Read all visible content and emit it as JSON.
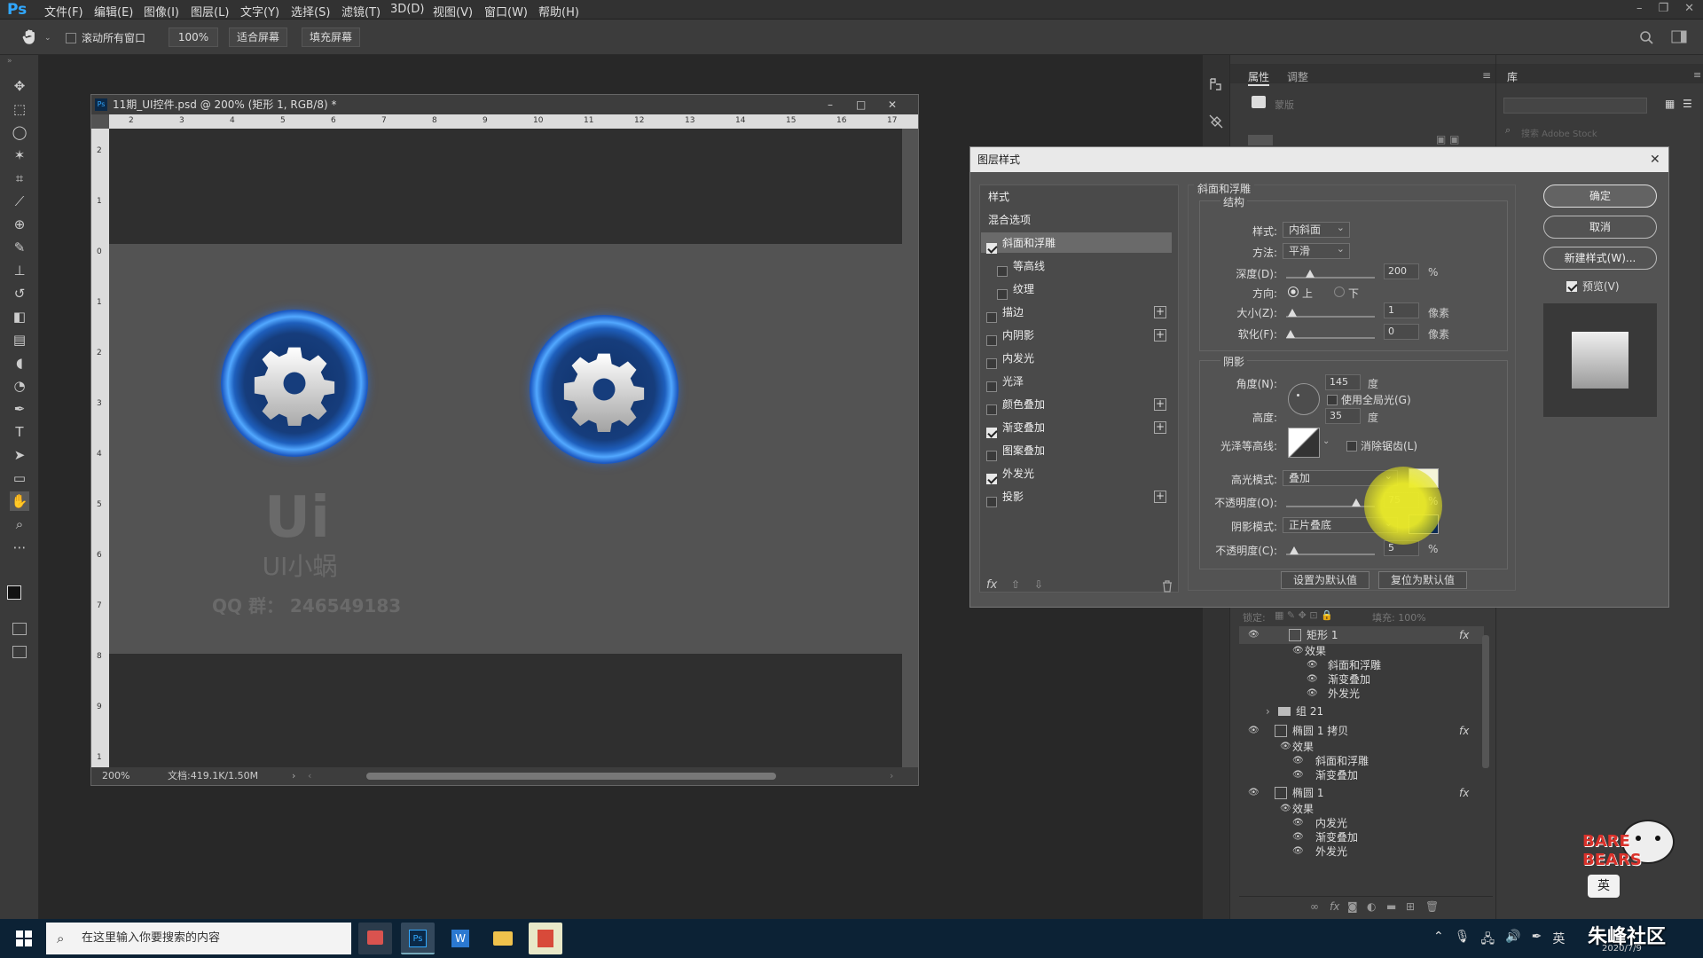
{
  "menubar": {
    "logo": "Ps",
    "items": [
      "文件(F)",
      "编辑(E)",
      "图像(I)",
      "图层(L)",
      "文字(Y)",
      "选择(S)",
      "滤镜(T)",
      "3D(D)",
      "视图(V)",
      "窗口(W)",
      "帮助(H)"
    ]
  },
  "options": {
    "scroll_all": "滚动所有窗口",
    "zoom_100": "100%",
    "fit_screen": "适合屏幕",
    "fill_screen": "填充屏幕"
  },
  "document": {
    "title": "11期_UI控件.psd @ 200% (矩形 1, RGB/8) *",
    "zoom": "200%",
    "doc_size": "文档:419.1K/1.50M",
    "ruler_h": [
      "2",
      "3",
      "4",
      "5",
      "6",
      "7",
      "8",
      "9",
      "10",
      "11",
      "12",
      "13",
      "14",
      "15",
      "16",
      "17"
    ],
    "ruler_v": [
      "2",
      "1",
      "0",
      "1",
      "2",
      "3",
      "4",
      "5",
      "6",
      "7",
      "8",
      "9",
      "1"
    ],
    "watermark_logo": "Ui",
    "watermark_name": "UI小蜗",
    "watermark_qq": "QQ 群： 246549183"
  },
  "props_panel": {
    "tabs": [
      "属性",
      "调整"
    ],
    "library_tab": "库",
    "mask_label": "蒙版",
    "search_placeholder": "搜索 Adobe Stock"
  },
  "dialog": {
    "title": "图层样式",
    "styles_header": "样式",
    "blend_options": "混合选项",
    "effects": [
      {
        "label": "斜面和浮雕",
        "checked": true,
        "indent": false,
        "plus": false,
        "active": true
      },
      {
        "label": "等高线",
        "checked": false,
        "indent": true,
        "plus": false,
        "active": false
      },
      {
        "label": "纹理",
        "checked": false,
        "indent": true,
        "plus": false,
        "active": false
      },
      {
        "label": "描边",
        "checked": false,
        "indent": false,
        "plus": true,
        "active": false
      },
      {
        "label": "内阴影",
        "checked": false,
        "indent": false,
        "plus": true,
        "active": false
      },
      {
        "label": "内发光",
        "checked": false,
        "indent": false,
        "plus": false,
        "active": false
      },
      {
        "label": "光泽",
        "checked": false,
        "indent": false,
        "plus": false,
        "active": false
      },
      {
        "label": "颜色叠加",
        "checked": false,
        "indent": false,
        "plus": true,
        "active": false
      },
      {
        "label": "渐变叠加",
        "checked": true,
        "indent": false,
        "plus": true,
        "active": false
      },
      {
        "label": "图案叠加",
        "checked": false,
        "indent": false,
        "plus": false,
        "active": false
      },
      {
        "label": "外发光",
        "checked": true,
        "indent": false,
        "plus": false,
        "active": false
      },
      {
        "label": "投影",
        "checked": false,
        "indent": false,
        "plus": true,
        "active": false
      }
    ],
    "fx_label": "fx",
    "section_title": "斜面和浮雕",
    "structure": {
      "title": "结构",
      "style_label": "样式:",
      "style_value": "内斜面",
      "technique_label": "方法:",
      "technique_value": "平滑",
      "depth_label": "深度(D):",
      "depth_value": "200",
      "depth_unit": "%",
      "direction_label": "方向:",
      "dir_up": "上",
      "dir_down": "下",
      "size_label": "大小(Z):",
      "size_value": "1",
      "size_unit": "像素",
      "soften_label": "软化(F):",
      "soften_value": "0",
      "soften_unit": "像素"
    },
    "shading": {
      "title": "阴影",
      "angle_label": "角度(N):",
      "angle_value": "145",
      "angle_unit": "度",
      "global_light": "使用全局光(G)",
      "altitude_label": "高度:",
      "altitude_value": "35",
      "altitude_unit": "度",
      "gloss_label": "光泽等高线:",
      "anti_alias": "消除锯齿(L)",
      "highlight_mode_label": "高光模式:",
      "highlight_mode": "叠加",
      "highlight_opacity_label": "不透明度(O):",
      "highlight_opacity": "75",
      "highlight_opacity_unit": "%",
      "shadow_mode_label": "阴影模式:",
      "shadow_mode": "正片叠底",
      "shadow_opacity_label": "不透明度(C):",
      "shadow_opacity": "5",
      "shadow_opacity_unit": "%"
    },
    "make_default": "设置为默认值",
    "reset_default": "复位为默认值",
    "ok": "确定",
    "cancel": "取消",
    "new_style": "新建样式(W)...",
    "preview": "预览(V)"
  },
  "layers": {
    "lock_label": "锁定:",
    "fill_label": "填充: 100%",
    "rows": [
      {
        "name": "矩形 1",
        "type": "layer",
        "fx": true,
        "eye": true
      },
      {
        "name": "效果",
        "type": "effects",
        "fx": false,
        "eye": true
      },
      {
        "name": "斜面和浮雕",
        "type": "effect",
        "fx": false,
        "eye": true
      },
      {
        "name": "渐变叠加",
        "type": "effect",
        "fx": false,
        "eye": true
      },
      {
        "name": "外发光",
        "type": "effect",
        "fx": false,
        "eye": true
      },
      {
        "name": "组 21",
        "type": "group",
        "fx": false,
        "eye": false
      },
      {
        "name": "椭圆 1 拷贝",
        "type": "layer",
        "fx": true,
        "eye": true
      },
      {
        "name": "效果",
        "type": "effects",
        "fx": false,
        "eye": true
      },
      {
        "name": "斜面和浮雕",
        "type": "effect",
        "fx": false,
        "eye": true
      },
      {
        "name": "渐变叠加",
        "type": "effect",
        "fx": false,
        "eye": true
      },
      {
        "name": "椭圆 1",
        "type": "layer",
        "fx": true,
        "eye": true
      },
      {
        "name": "效果",
        "type": "effects",
        "fx": false,
        "eye": true
      },
      {
        "name": "内发光",
        "type": "effect",
        "fx": false,
        "eye": true
      },
      {
        "name": "渐变叠加",
        "type": "effect",
        "fx": false,
        "eye": true
      },
      {
        "name": "外发光",
        "type": "effect",
        "fx": false,
        "eye": true
      }
    ]
  },
  "taskbar": {
    "search_placeholder": "在这里输入你要搜索的内容",
    "ime": "英",
    "watermark": "朱峰社区",
    "watermark_date": "2020/7/9"
  }
}
